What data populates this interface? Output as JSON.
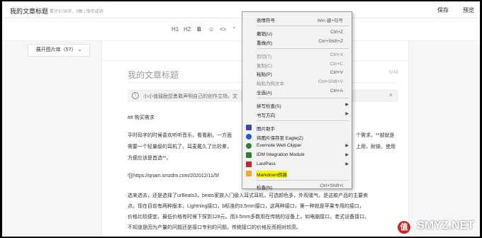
{
  "header": {
    "title": "我的文章标题",
    "meta": "累计3738字，0图 | 保存成功",
    "save_label": "保存",
    "preview_label": "预览"
  },
  "toolbar": {
    "icons": [
      "H1",
      "H2",
      "B",
      "☺",
      "<>",
      "“",
      "≡"
    ]
  },
  "sidebar": {
    "library_label": "展开图片库（57）"
  },
  "editor": {
    "title": "我的文章标题",
    "counter": "0/48",
    "notice": "小小值鼓励您勇敢声明自己的创作立场，文",
    "lines": [
      "## 购买需求",
      "平时码字的时候喜欢听听音乐，看看剧，一方面",
      "个需求。**部就是",
      "需要一个轻量级的耳机了，耳麦戴久了比较累，",
      "上用，耐操，使用",
      "方便应该是首选**。",
      "![](https://qnam.smzdm.com/202012/11/5f",
      "选来选去，还是选择了urBeats3，beats家族入门级入耳式耳机，可选颜色多，外观骚气，是这款产品的主要卖",
      "点。现在目前有两种版本，Lightning接口，b标准的3.5mm接口，这两种接口，第一种就是苹果专用的接口，",
      "价格比较便宜，最低价格有时候下探到128元。而3.5mm多数用在传统的设备上，如电脑接口，老式设备接口，",
      "不知道是因为产量的问题还是接口专利的问题，传统接口的价格反而相对较高。"
    ]
  },
  "context_menu": {
    "items": [
      {
        "label": "表情符号",
        "shortcut": "Win 键+句号"
      },
      {
        "label": "撤销(U)",
        "shortcut": "Ctrl+Z"
      },
      {
        "label": "重做(R)",
        "shortcut": "Ctrl+Shift+Z"
      },
      {
        "label": "剪切(T)",
        "shortcut": "Ctrl+X"
      },
      {
        "label": "复制(C)",
        "shortcut": "Ctrl+C"
      },
      {
        "label": "粘贴(P)",
        "shortcut": "Ctrl+V"
      },
      {
        "label": "粘贴为纯文本",
        "shortcut": "Ctrl+Shift+V"
      },
      {
        "label": "全选(A)",
        "shortcut": "Ctrl+A"
      },
      {
        "label": "拼写检查(S)",
        "shortcut": ""
      },
      {
        "label": "书写方向",
        "shortcut": ""
      },
      {
        "label": "图片助手",
        "shortcut": ""
      },
      {
        "label": "将图片保存至 Eagle(Z)",
        "shortcut": ""
      },
      {
        "label": "Evernote Web Clipper",
        "shortcut": ""
      },
      {
        "label": "IDM Integration Module",
        "shortcut": ""
      },
      {
        "label": "LastPass",
        "shortcut": ""
      },
      {
        "label": "Markdown转换",
        "shortcut": ""
      },
      {
        "label": "检查(N)",
        "shortcut": "Ctrl+Shift+I"
      }
    ]
  },
  "watermark": {
    "text": "SMYZ.NET",
    "badge": "值"
  },
  "colors": {
    "highlight": "#f7f700",
    "eagle": "#1565c0",
    "evernote": "#2e7d32",
    "idm": "#2e7d32",
    "lastpass": "#c62828",
    "markdown": "#f5a623",
    "imghelper": "#3949ab"
  }
}
